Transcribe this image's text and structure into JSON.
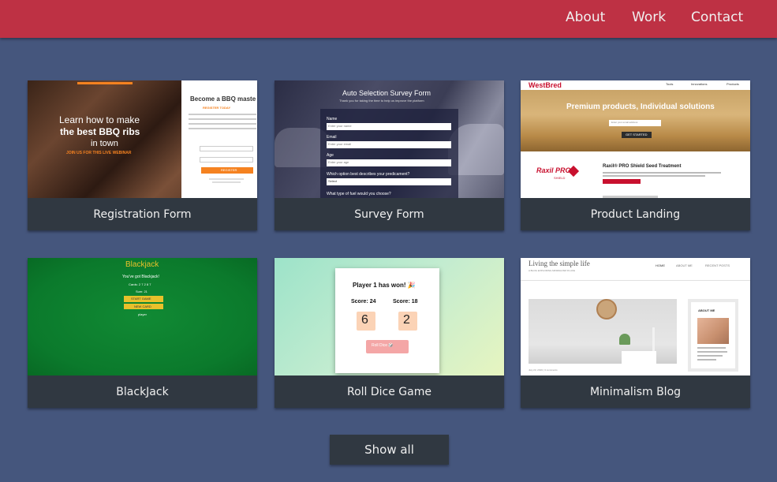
{
  "nav": {
    "about": "About",
    "work": "Work",
    "contact": "Contact"
  },
  "projects": [
    {
      "title": "Registration Form",
      "thumb": {
        "headline_1": "Learn how to make",
        "headline_2": "the best BBQ ribs",
        "headline_3": "in town",
        "cta": "JOIN US FOR THIS LIVE WEBINAR",
        "side_title": "Become a BBQ maste",
        "side_sub": "REGISTER TODAY",
        "button": "REGISTER"
      }
    },
    {
      "title": "Survey Form",
      "thumb": {
        "heading": "Auto Selection Survey Form",
        "sub": "Thank you for taking the time to help us improve the platform",
        "fields": [
          {
            "label": "Name",
            "placeholder": "Enter your name"
          },
          {
            "label": "Email",
            "placeholder": "Enter your email"
          },
          {
            "label": "Age",
            "placeholder": "Enter your age"
          }
        ],
        "question": "Which option best describes your predicament?",
        "select": "Select",
        "question2": "What type of fuel would you choose?"
      }
    },
    {
      "title": "Product Landing",
      "thumb": {
        "logo": "WestBred",
        "nav": [
          "Tools",
          "Innovations",
          "Products"
        ],
        "hero": "Premium products, Individual solutions",
        "email_placeholder": "Enter your email address",
        "button": "GET STARTED",
        "product": "Raxil® PRO Shield Seed Treatment",
        "product_logo": "Raxil PRO",
        "product_logo_sub": "SHIELD"
      }
    },
    {
      "title": "BlackJack",
      "thumb": {
        "heading": "Blackjack",
        "message": "You've got Blackjack!",
        "cards": "Cards: 2 7 2 8 7",
        "sum": "Sum: 21",
        "start": "START GAME",
        "new": "NEW CARD",
        "player": "player"
      }
    },
    {
      "title": "Roll Dice Game",
      "thumb": {
        "winner": "Player 1 has won! 🎉",
        "score1": "Score: 24",
        "score2": "Score: 18",
        "die1": "6",
        "die2": "2",
        "button": "Roll Dice 🎲"
      }
    },
    {
      "title": "Minimalism Blog",
      "thumb": {
        "title": "Living the simple life",
        "tagline": "A BLOG EXPLORING MINIMALISM IN LIFE",
        "nav": [
          "HOME",
          "ABOUT ME",
          "RECENT POSTS"
        ],
        "about": "ABOUT ME",
        "date": "July 23, 2019 | 3 comments"
      }
    }
  ],
  "show_all": "Show all"
}
